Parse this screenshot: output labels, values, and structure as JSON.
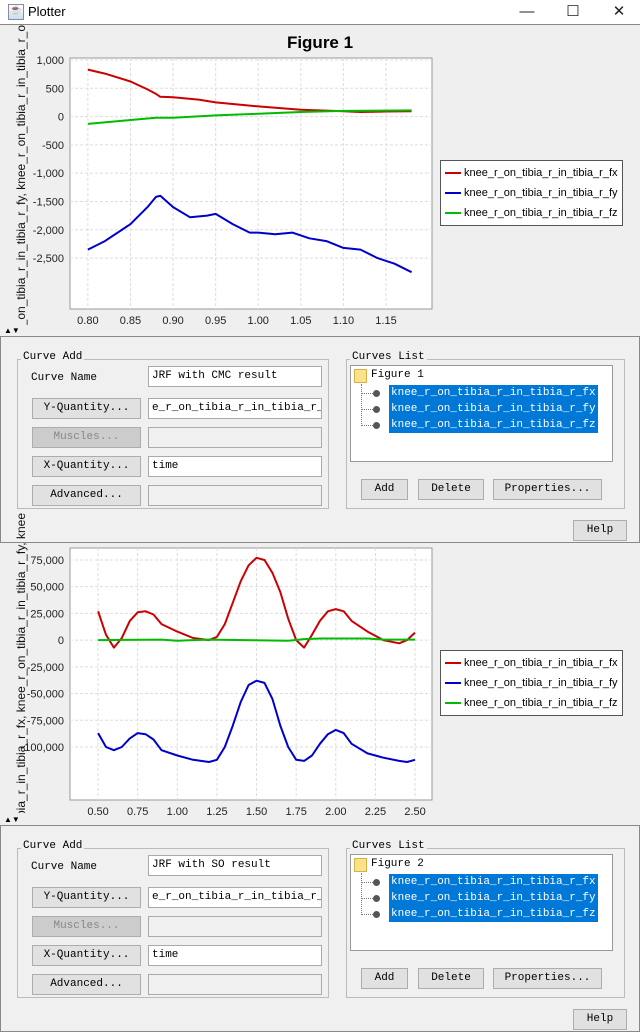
{
  "window": {
    "title": "Plotter",
    "controls": [
      "minimize",
      "maximize",
      "close"
    ]
  },
  "plots": [
    {
      "title": "Figure 1",
      "ylabel": "knee_r_on_tibia_r_in_tibia_r_fx, knee_r_on_tibia_r_in_tibia_r_fy, knee_r_on_tibia_r_in_tibia_r_o",
      "legend": [
        "knee_r_on_tibia_r_in_tibia_r_fx",
        "knee_r_on_tibia_r_in_tibia_r_fy",
        "knee_r_on_tibia_r_in_tibia_r_fz"
      ]
    },
    {
      "title": "",
      "ylabel": "knee_r_on_tibia_r_in_tibia_r_fx, knee_r_on_tibia_r_in_tibia_r_fy, knee",
      "legend": [
        "knee_r_on_tibia_r_in_tibia_r_fx",
        "knee_r_on_tibia_r_in_tibia_r_fy",
        "knee_r_on_tibia_r_in_tibia_r_fz"
      ]
    }
  ],
  "chart_data": [
    {
      "type": "line",
      "title": "Figure 1",
      "xlabel": "time",
      "xlim": [
        0.779,
        1.204
      ],
      "ylim": [
        -3400,
        1035
      ],
      "xticks": [
        "0.80",
        "0.85",
        "0.90",
        "0.95",
        "1.00",
        "1.05",
        "1.10",
        "1.15"
      ],
      "yticks": [
        "1,000",
        "500",
        "0",
        "-500",
        "-1,000",
        "-1,500",
        "-2,000",
        "-2,500"
      ],
      "grid": true,
      "legend_position": "right",
      "series": [
        {
          "name": "knee_r_on_tibia_r_in_tibia_r_fx",
          "color": "#cc0000",
          "x": [
            0.8,
            0.82,
            0.85,
            0.87,
            0.88,
            0.885,
            0.9,
            0.93,
            0.95,
            1.0,
            1.05,
            1.1,
            1.12,
            1.15,
            1.18
          ],
          "y": [
            830,
            760,
            620,
            480,
            400,
            350,
            340,
            300,
            250,
            180,
            120,
            95,
            80,
            90,
            95
          ]
        },
        {
          "name": "knee_r_on_tibia_r_in_tibia_r_fy",
          "color": "#0000cc",
          "x": [
            0.8,
            0.82,
            0.85,
            0.87,
            0.88,
            0.885,
            0.9,
            0.92,
            0.94,
            0.95,
            0.97,
            0.99,
            1.0,
            1.02,
            1.04,
            1.06,
            1.08,
            1.1,
            1.12,
            1.14,
            1.16,
            1.18
          ],
          "y": [
            -2350,
            -2200,
            -1900,
            -1600,
            -1420,
            -1400,
            -1600,
            -1780,
            -1750,
            -1720,
            -1900,
            -2050,
            -2050,
            -2080,
            -2050,
            -2150,
            -2200,
            -2320,
            -2350,
            -2500,
            -2600,
            -2750
          ]
        },
        {
          "name": "knee_r_on_tibia_r_in_tibia_r_fz",
          "color": "#00bb00",
          "x": [
            0.8,
            0.85,
            0.88,
            0.9,
            0.95,
            1.0,
            1.05,
            1.1,
            1.18
          ],
          "y": [
            -130,
            -60,
            -20,
            -20,
            20,
            50,
            80,
            100,
            110
          ]
        }
      ]
    },
    {
      "type": "line",
      "title": "",
      "xlabel": "time",
      "xlim": [
        0.323,
        2.607
      ],
      "ylim": [
        -149600,
        86200
      ],
      "xticks": [
        "0.50",
        "0.75",
        "1.00",
        "1.25",
        "1.50",
        "1.75",
        "2.00",
        "2.25",
        "2.50"
      ],
      "yticks": [
        "75,000",
        "50,000",
        "25,000",
        "0",
        "-25,000",
        "-50,000",
        "-75,000",
        "-100,000"
      ],
      "grid": true,
      "legend_position": "right",
      "series": [
        {
          "name": "knee_r_on_tibia_r_in_tibia_r_fx",
          "color": "#cc0000",
          "x": [
            0.5,
            0.55,
            0.6,
            0.65,
            0.7,
            0.75,
            0.8,
            0.85,
            0.9,
            1.0,
            1.1,
            1.2,
            1.25,
            1.3,
            1.35,
            1.4,
            1.45,
            1.5,
            1.55,
            1.6,
            1.65,
            1.7,
            1.75,
            1.8,
            1.85,
            1.9,
            1.95,
            2.0,
            2.05,
            2.1,
            2.2,
            2.3,
            2.4,
            2.45,
            2.5
          ],
          "y": [
            27000,
            5000,
            -7000,
            2000,
            18000,
            26000,
            27000,
            24000,
            15000,
            8000,
            2000,
            0,
            3000,
            15000,
            35000,
            55000,
            70000,
            77000,
            75000,
            63000,
            45000,
            20000,
            0,
            -7000,
            5000,
            18000,
            27000,
            29000,
            27000,
            18000,
            8000,
            0,
            -3000,
            0,
            7000
          ]
        },
        {
          "name": "knee_r_on_tibia_r_in_tibia_r_fy",
          "color": "#0000cc",
          "x": [
            0.5,
            0.55,
            0.6,
            0.65,
            0.7,
            0.75,
            0.8,
            0.85,
            0.9,
            1.0,
            1.1,
            1.2,
            1.25,
            1.3,
            1.35,
            1.4,
            1.45,
            1.5,
            1.55,
            1.6,
            1.65,
            1.7,
            1.75,
            1.8,
            1.85,
            1.9,
            1.95,
            2.0,
            2.05,
            2.1,
            2.2,
            2.3,
            2.4,
            2.45,
            2.5
          ],
          "y": [
            -87000,
            -100000,
            -103000,
            -100000,
            -92000,
            -87000,
            -88000,
            -93000,
            -103000,
            -108000,
            -112000,
            -114000,
            -112000,
            -100000,
            -80000,
            -58000,
            -42000,
            -38000,
            -40000,
            -55000,
            -80000,
            -100000,
            -112000,
            -113000,
            -108000,
            -97000,
            -88000,
            -84000,
            -87000,
            -97000,
            -106000,
            -110000,
            -113000,
            -114000,
            -112000
          ]
        },
        {
          "name": "knee_r_on_tibia_r_in_tibia_r_fz",
          "color": "#00bb00",
          "x": [
            0.5,
            0.9,
            1.0,
            1.1,
            1.2,
            1.7,
            1.8,
            1.9,
            2.2,
            2.3,
            2.5
          ],
          "y": [
            0,
            500,
            -500,
            0,
            500,
            -500,
            1000,
            1500,
            1500,
            500,
            500
          ]
        }
      ]
    }
  ],
  "panels": [
    {
      "curve_add": {
        "legend": "Curve Add",
        "curve_name_label": "Curve Name",
        "curve_name": "JRF with CMC result",
        "y_button": "Y-Quantity...",
        "y_value": "e_r_on_tibia_r_in_tibia_r_fz",
        "muscles_button": "Muscles...",
        "muscles_value": "",
        "x_button": "X-Quantity...",
        "x_value": "time",
        "advanced_button": "Advanced...",
        "advanced_value": ""
      },
      "curves_list": {
        "legend": "Curves List",
        "folder": "Figure 1",
        "items": [
          "knee_r_on_tibia_r_in_tibia_r_fx",
          "knee_r_on_tibia_r_in_tibia_r_fy",
          "knee_r_on_tibia_r_in_tibia_r_fz"
        ],
        "add": "Add",
        "delete": "Delete",
        "properties": "Properties..."
      },
      "help": "Help"
    },
    {
      "curve_add": {
        "legend": "Curve Add",
        "curve_name_label": "Curve Name",
        "curve_name": "JRF with SO result",
        "y_button": "Y-Quantity...",
        "y_value": "e_r_on_tibia_r_in_tibia_r_fz",
        "muscles_button": "Muscles...",
        "muscles_value": "",
        "x_button": "X-Quantity...",
        "x_value": "time",
        "advanced_button": "Advanced...",
        "advanced_value": ""
      },
      "curves_list": {
        "legend": "Curves List",
        "folder": "Figure 2",
        "items": [
          "knee_r_on_tibia_r_in_tibia_r_fx",
          "knee_r_on_tibia_r_in_tibia_r_fy",
          "knee_r_on_tibia_r_in_tibia_r_fz"
        ],
        "add": "Add",
        "delete": "Delete",
        "properties": "Properties..."
      },
      "help": "Help"
    }
  ]
}
